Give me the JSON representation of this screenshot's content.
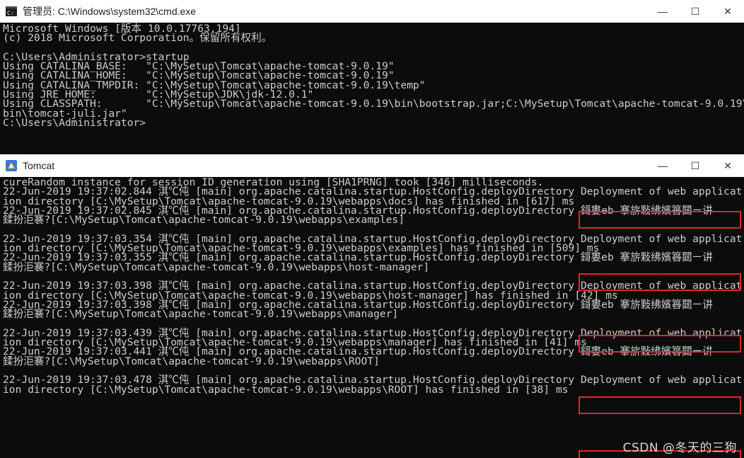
{
  "cmd_window": {
    "title": "管理员: C:\\Windows\\system32\\cmd.exe",
    "lines": [
      "Microsoft Windows [版本 10.0.17763.194]",
      "(c) 2018 Microsoft Corporation。保留所有权利。",
      "",
      "C:\\Users\\Administrator>startup",
      "Using CATALINA_BASE:   \"C:\\MySetup\\Tomcat\\apache-tomcat-9.0.19\"",
      "Using CATALINA_HOME:   \"C:\\MySetup\\Tomcat\\apache-tomcat-9.0.19\"",
      "Using CATALINA_TMPDIR: \"C:\\MySetup\\Tomcat\\apache-tomcat-9.0.19\\temp\"",
      "Using JRE_HOME:        \"C:\\MySetup\\JDK\\jdk-12.0.1\"",
      "Using CLASSPATH:       \"C:\\MySetup\\Tomcat\\apache-tomcat-9.0.19\\bin\\bootstrap.jar;C:\\MySetup\\Tomcat\\apache-tomcat-9.0.19\\",
      "bin\\tomcat-juli.jar\"",
      "C:\\Users\\Administrator>"
    ]
  },
  "tomcat_window": {
    "title": "Tomcat",
    "lines": [
      "cureRandom instance for session ID generation using [SHA1PRNG] took [346] milliseconds.",
      "22-Jun-2019 19:37:02.844 淇℃伅 [main] org.apache.catalina.startup.HostConfig.deployDirectory Deployment of web applicat",
      "ion directory [C:\\MySetup\\Tomcat\\apache-tomcat-9.0.19\\webapps\\docs] has finished in [617] ms",
      "22-Jun-2019 19:37:02.845 淇℃伅 [main] org.apache.catalina.startup.HostConfig.deployDirectory 鎶婁eb 搴旂敤绋嬪簭閮ㄧ讲",
      "鍒扮洰褰?[C:\\MySetup\\Tomcat\\apache-tomcat-9.0.19\\webapps\\examples]",
      "",
      "22-Jun-2019 19:37:03.354 淇℃伅 [main] org.apache.catalina.startup.HostConfig.deployDirectory Deployment of web applicat",
      "ion directory [C:\\MySetup\\Tomcat\\apache-tomcat-9.0.19\\webapps\\examples] has finished in [509] ms",
      "22-Jun-2019 19:37:03.355 淇℃伅 [main] org.apache.catalina.startup.HostConfig.deployDirectory 鎶婁eb 搴旂敤绋嬪簭閮ㄧ讲",
      "鍒扮洰褰?[C:\\MySetup\\Tomcat\\apache-tomcat-9.0.19\\webapps\\host-manager]",
      "",
      "22-Jun-2019 19:37:03.398 淇℃伅 [main] org.apache.catalina.startup.HostConfig.deployDirectory Deployment of web applicat",
      "ion directory [C:\\MySetup\\Tomcat\\apache-tomcat-9.0.19\\webapps\\host-manager] has finished in [42] ms",
      "22-Jun-2019 19:37:03.398 淇℃伅 [main] org.apache.catalina.startup.HostConfig.deployDirectory 鎶婁eb 搴旂敤绋嬪簭閮ㄧ讲",
      "鍒扮洰褰?[C:\\MySetup\\Tomcat\\apache-tomcat-9.0.19\\webapps\\manager]",
      "",
      "22-Jun-2019 19:37:03.439 淇℃伅 [main] org.apache.catalina.startup.HostConfig.deployDirectory Deployment of web applicat",
      "ion directory [C:\\MySetup\\Tomcat\\apache-tomcat-9.0.19\\webapps\\manager] has finished in [41] ms",
      "22-Jun-2019 19:37:03.441 淇℃伅 [main] org.apache.catalina.startup.HostConfig.deployDirectory 鎶婁eb 搴旂敤绋嬪簭閮ㄧ讲",
      "鍒扮洰褰?[C:\\MySetup\\Tomcat\\apache-tomcat-9.0.19\\webapps\\ROOT]",
      "",
      "22-Jun-2019 19:37:03.478 淇℃伅 [main] org.apache.catalina.startup.HostConfig.deployDirectory Deployment of web applicat",
      "ion directory [C:\\MySetup\\Tomcat\\apache-tomcat-9.0.19\\webapps\\ROOT] has finished in [38] ms"
    ]
  },
  "window_controls": {
    "minimize": "—",
    "maximize": "☐",
    "close": "✕"
  },
  "watermark": "CSDN @冬天的三狗",
  "colors": {
    "console_bg": "#0c0c0c",
    "console_text": "#cccccc",
    "highlight": "#e0262b",
    "titlebar": "#ffffff"
  }
}
